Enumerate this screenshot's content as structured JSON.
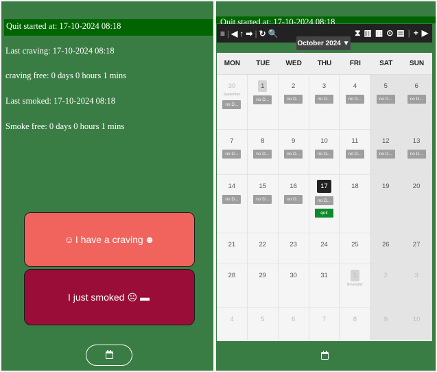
{
  "left": {
    "stats": [
      "Quit started at: 17-10-2024 08:18",
      "Last craving: 17-10-2024 08:18",
      "craving free: 0 days 0 hours 1 mins",
      "Last smoked: 17-10-2024 08:18",
      "Smoke free: 0 days 0 hours 1 mins"
    ],
    "craving_label": "I have a craving",
    "smoked_label": "I just smoked"
  },
  "right": {
    "peek_text": "Quit started at: 17-10-2024 08:18",
    "month_label": "October 2024 ▼",
    "toolbar_left": [
      "≡",
      "|",
      "◀",
      "↑",
      "➡",
      "|",
      "↻",
      "🔍"
    ],
    "toolbar_right": [
      "⧗",
      "▥",
      "▦",
      "⊙",
      "▤",
      "|",
      "+",
      "▶"
    ],
    "weekdays": [
      "MON",
      "TUE",
      "WED",
      "THU",
      "FRI",
      "SAT",
      "SUN"
    ],
    "weeks": [
      [
        {
          "d": "30",
          "sub": "September",
          "muted": true,
          "ev": [
            "no D..."
          ]
        },
        {
          "d": "1",
          "boxed": true,
          "ev": [
            "no D..."
          ]
        },
        {
          "d": "2",
          "ev": [
            "no D..."
          ]
        },
        {
          "d": "3",
          "ev": [
            "no D..."
          ]
        },
        {
          "d": "4",
          "ev": [
            "no D..."
          ]
        },
        {
          "d": "5",
          "ev": [
            "no D..."
          ]
        },
        {
          "d": "6",
          "ev": [
            "no D..."
          ]
        }
      ],
      [
        {
          "d": "7",
          "ev": [
            "no D..."
          ]
        },
        {
          "d": "8",
          "ev": [
            "no D..."
          ]
        },
        {
          "d": "9",
          "ev": [
            "no D..."
          ]
        },
        {
          "d": "10",
          "ev": [
            "no D..."
          ]
        },
        {
          "d": "11",
          "ev": [
            "no D..."
          ]
        },
        {
          "d": "12",
          "ev": [
            "no D..."
          ]
        },
        {
          "d": "13",
          "ev": [
            "no D..."
          ]
        }
      ],
      [
        {
          "d": "14",
          "ev": [
            "no D..."
          ]
        },
        {
          "d": "15",
          "ev": [
            "no D..."
          ]
        },
        {
          "d": "16",
          "ev": [
            "no D..."
          ]
        },
        {
          "d": "17",
          "today": true,
          "ev": [
            "no D..."
          ],
          "quit": "quit"
        },
        {
          "d": "18"
        },
        {
          "d": "19"
        },
        {
          "d": "20"
        }
      ],
      [
        {
          "d": "21"
        },
        {
          "d": "22"
        },
        {
          "d": "23"
        },
        {
          "d": "24"
        },
        {
          "d": "25"
        },
        {
          "d": "26"
        },
        {
          "d": "27"
        }
      ],
      [
        {
          "d": "28"
        },
        {
          "d": "29"
        },
        {
          "d": "30"
        },
        {
          "d": "31"
        },
        {
          "d": "1",
          "sub": "November",
          "muted": true,
          "boxed": true
        },
        {
          "d": "2",
          "muted": true
        },
        {
          "d": "3",
          "muted": true
        }
      ],
      [
        {
          "d": "4",
          "muted": true
        },
        {
          "d": "5",
          "muted": true
        },
        {
          "d": "6",
          "muted": true
        },
        {
          "d": "7",
          "muted": true
        },
        {
          "d": "8",
          "muted": true
        },
        {
          "d": "9",
          "muted": true
        },
        {
          "d": "10",
          "muted": true
        }
      ]
    ]
  },
  "colors": {
    "background_green": "#3a7d44",
    "header_green": "#006400",
    "craving_button": "#f0645d",
    "smoked_button": "#9a0d38",
    "quit_event": "#0e8a2c",
    "event_gray": "#9e9e9e"
  },
  "icons": {
    "craving_left": "smile-face-icon",
    "craving_right": "craving-face-icon",
    "smoked_face": "sad-face-icon",
    "smoked_cigarette": "cigarette-icon",
    "calendar_toggle": "calendar-icon"
  }
}
